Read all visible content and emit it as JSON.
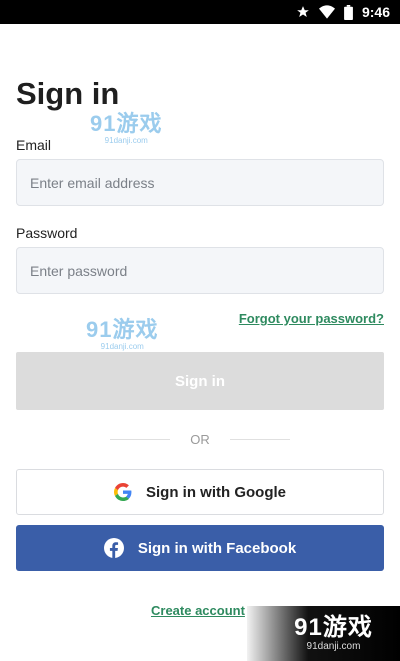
{
  "status_bar": {
    "time": "9:46",
    "icons": [
      "star-icon",
      "wifi-icon",
      "battery-icon"
    ]
  },
  "page": {
    "title": "Sign in"
  },
  "form": {
    "email": {
      "label": "Email",
      "placeholder": "Enter email address",
      "value": ""
    },
    "password": {
      "label": "Password",
      "placeholder": "Enter password",
      "value": ""
    },
    "forgot_label": "Forgot your password?",
    "signin_label": "Sign in",
    "or_label": "OR",
    "google_label": "Sign in with Google",
    "facebook_label": "Sign in with Facebook",
    "create_label": "Create account"
  },
  "watermark": {
    "main": "91游戏",
    "sub": "91danji.com"
  },
  "colors": {
    "link": "#2e8a5f",
    "facebook": "#3a5ea8",
    "disabled_button": "#dcdcdc",
    "input_bg": "#f4f6f9"
  }
}
